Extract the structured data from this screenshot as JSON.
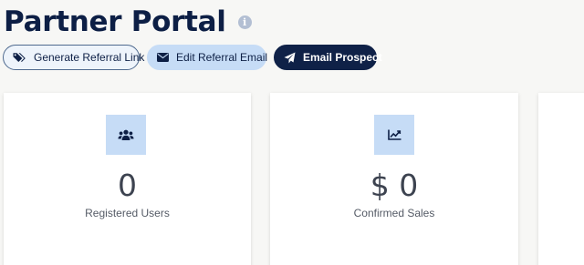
{
  "header": {
    "title": "Partner Portal",
    "info_icon": "info-icon",
    "buttons": [
      {
        "label": "Generate Referral Link",
        "icon": "tags-icon"
      },
      {
        "label": "Edit Referral Email",
        "icon": "envelope-icon"
      },
      {
        "label": "Email Prospect",
        "icon": "paper-plane-icon"
      }
    ]
  },
  "cards": [
    {
      "value": "0",
      "label": "Registered Users",
      "icon": "users-icon"
    },
    {
      "value": "$ 0",
      "label": "Confirmed Sales",
      "icon": "chart-line-icon"
    }
  ],
  "colors": {
    "primary": "#0f2147",
    "accent_light": "#c6dcf6",
    "background": "#f7f7f5"
  }
}
